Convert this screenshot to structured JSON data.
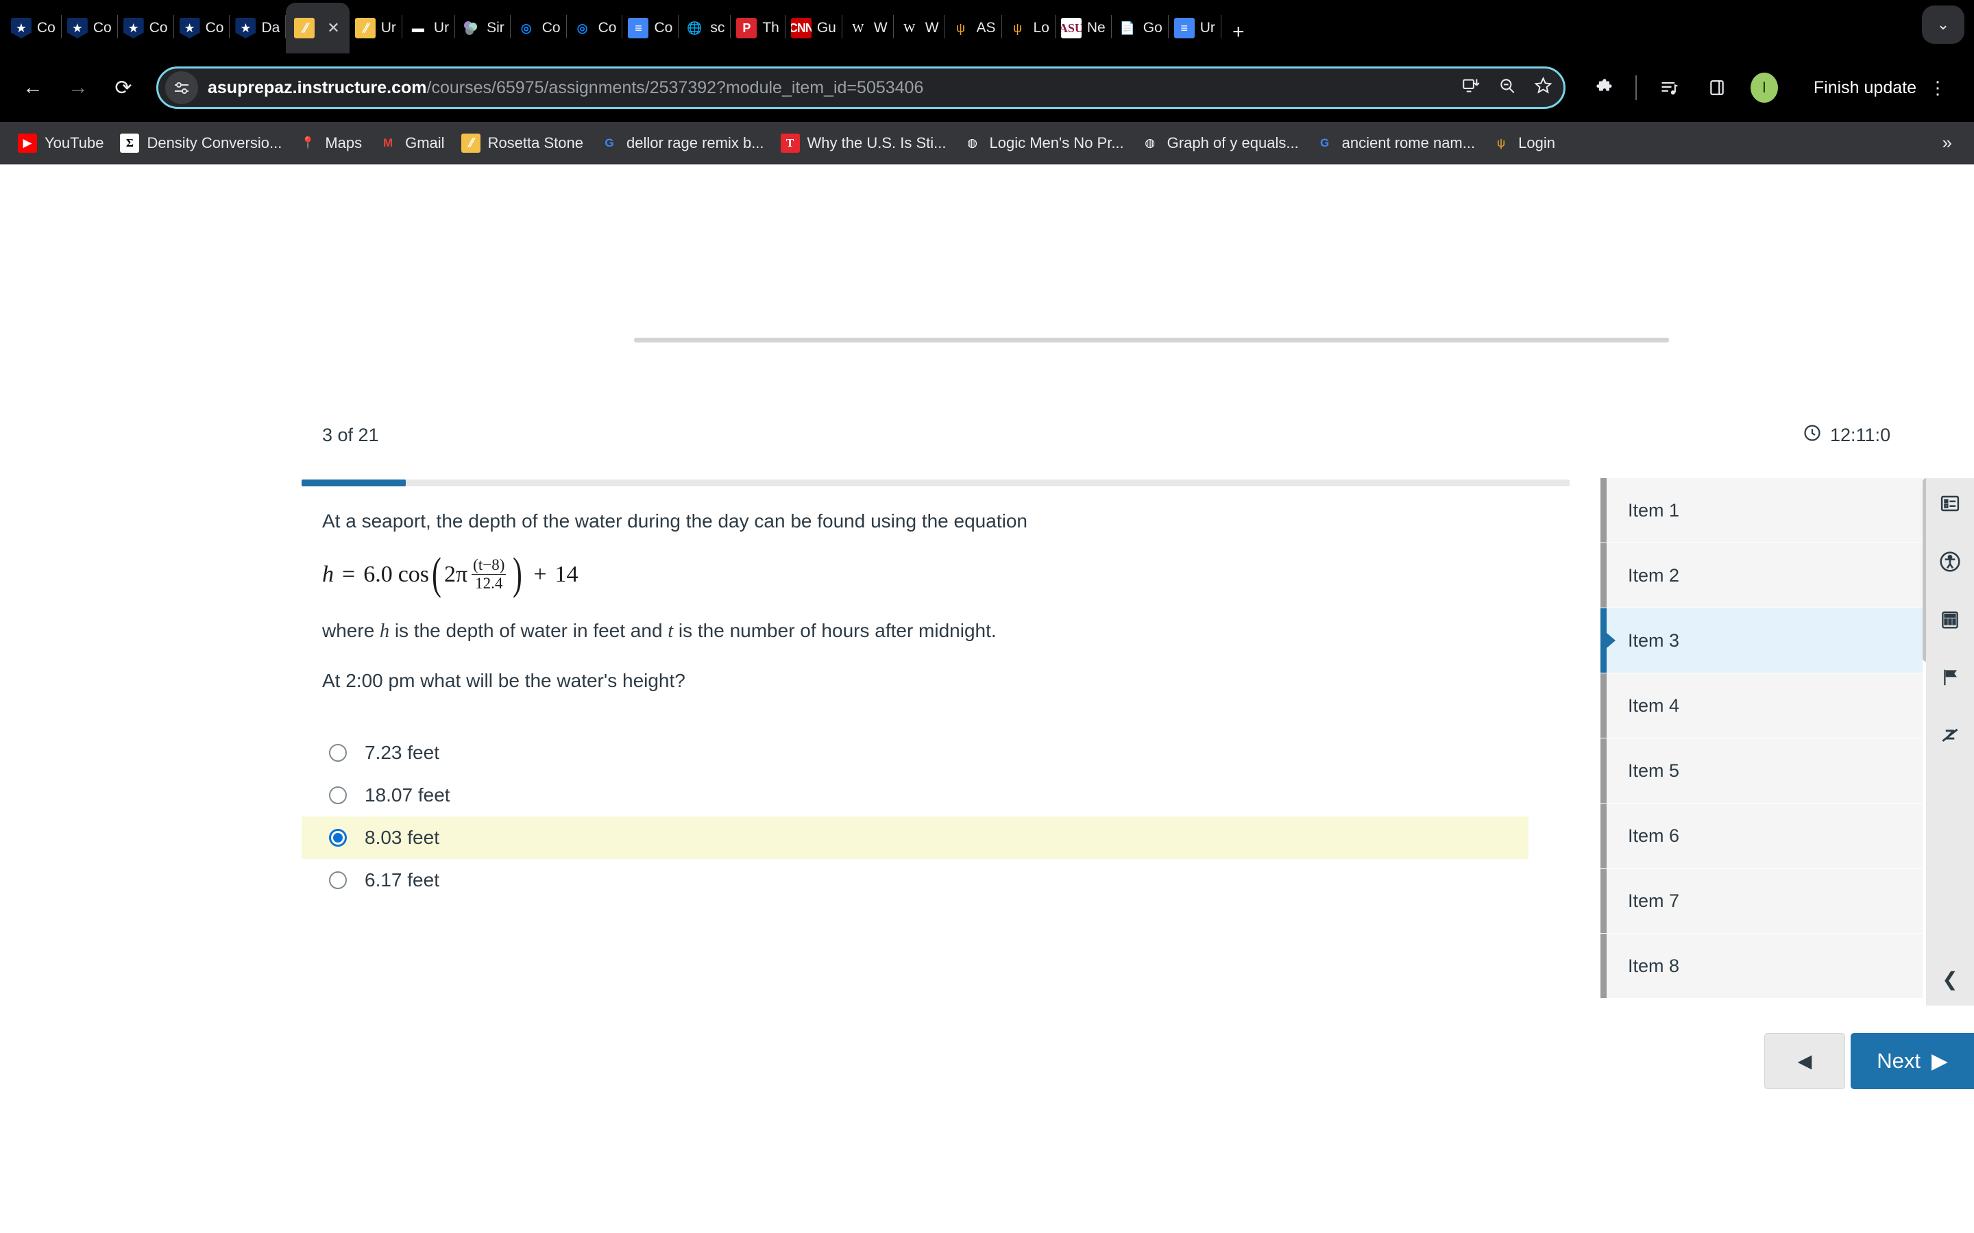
{
  "browser": {
    "tabs": [
      {
        "title": "Co",
        "icon": "canvas-icon",
        "active": false
      },
      {
        "title": "Co",
        "icon": "canvas-icon",
        "active": false
      },
      {
        "title": "Co",
        "icon": "canvas-icon",
        "active": false
      },
      {
        "title": "Co",
        "icon": "canvas-icon",
        "active": false
      },
      {
        "title": "Da",
        "icon": "canvas-icon",
        "active": false
      },
      {
        "title": "",
        "icon": "rosetta-stone-icon",
        "active": true
      },
      {
        "title": "Ur",
        "icon": "rosetta-stone-icon",
        "active": false
      },
      {
        "title": "Ur",
        "icon": "unit-converter-icon",
        "active": false
      },
      {
        "title": "Sir",
        "icon": "simulation-icon",
        "active": false
      },
      {
        "title": "Co",
        "icon": "coursehero-icon",
        "active": false
      },
      {
        "title": "Co",
        "icon": "coursehero-icon",
        "active": false
      },
      {
        "title": "Co",
        "icon": "google-docs-icon",
        "active": false
      },
      {
        "title": "sc",
        "icon": "globe-icon",
        "active": false
      },
      {
        "title": "Th",
        "icon": "pearson-icon",
        "active": false
      },
      {
        "title": "Gu",
        "icon": "cnn-icon",
        "active": false
      },
      {
        "title": "W",
        "icon": "wikipedia-icon",
        "active": false
      },
      {
        "title": "W",
        "icon": "wikipedia-icon",
        "active": false
      },
      {
        "title": "AS",
        "icon": "asu-pitchfork-icon",
        "active": false
      },
      {
        "title": "Lo",
        "icon": "asu-pitchfork-icon",
        "active": false
      },
      {
        "title": "Ne",
        "icon": "asu-logo-icon",
        "active": false
      },
      {
        "title": "Go",
        "icon": "google-doc-file-icon",
        "active": false
      },
      {
        "title": "Ur",
        "icon": "google-docs-icon",
        "active": false
      }
    ],
    "new_tab_label": "+",
    "tab_close_label": "✕",
    "nav": {
      "back": "←",
      "forward": "→",
      "reload": "⟳"
    },
    "omnibox": {
      "site_settings_icon": "tune-icon",
      "url_host": "asuprepaz.instructure.com",
      "url_path": "/courses/65975/assignments/2537392?module_item_id=5053406",
      "full_url": "asuprepaz.instructure.com/courses/65975/assignments/2537392?module_item_id=5053406",
      "install_icon": "install-app-icon",
      "zoom_icon": "zoom-out-icon",
      "bookmark_icon": "star-icon"
    },
    "toolbar": {
      "extensions_icon": "extensions-puzzle-icon",
      "reading_list_icon": "reading-list-icon",
      "side_panel_icon": "side-panel-icon",
      "profile_initial": "I",
      "finish_update_label": "Finish update",
      "menu_icon": "kebab-menu-icon"
    },
    "bookmarks": [
      {
        "label": "YouTube",
        "icon": "youtube-icon"
      },
      {
        "label": "Density Conversio...",
        "icon": "sigma-icon"
      },
      {
        "label": "Maps",
        "icon": "google-maps-icon"
      },
      {
        "label": "Gmail",
        "icon": "gmail-icon"
      },
      {
        "label": "Rosetta Stone",
        "icon": "rosetta-stone-icon"
      },
      {
        "label": "dellor rage remix b...",
        "icon": "google-icon"
      },
      {
        "label": "Why the U.S. Is Sti...",
        "icon": "time-magazine-icon"
      },
      {
        "label": "Logic Men's No Pr...",
        "icon": "socratic-icon"
      },
      {
        "label": "Graph of y equals...",
        "icon": "socratic-icon"
      },
      {
        "label": "ancient rome nam...",
        "icon": "google-icon"
      },
      {
        "label": "Login",
        "icon": "asu-pitchfork-icon"
      }
    ],
    "bookmarks_overflow_label": "»"
  },
  "quiz": {
    "position_label": "3 of 21",
    "timer_label": "12:11:0",
    "timer_icon": "clock-icon",
    "progress_percent": 8.2,
    "question": {
      "intro": "At a seaport, the depth of the water during the day can be found using the equation",
      "formula": {
        "lhs": "h",
        "equals": "=",
        "amplitude": "6.0",
        "function": "cos",
        "coefficient": "2π",
        "numerator": "(t−8)",
        "denominator": "12.4",
        "plus": "+",
        "vertical_shift": "14",
        "plain": "h = 6.0 cos(2π (t−8)/12.4) + 14"
      },
      "where_prefix": "where ",
      "where_var1": "h",
      "where_mid": " is the depth of water in feet and ",
      "where_var2": "t",
      "where_suffix": " is the number of hours after midnight.",
      "prompt": "At 2:00 pm what will be the water's height?"
    },
    "answers": [
      {
        "label": "7.23 feet",
        "selected": false
      },
      {
        "label": "18.07 feet",
        "selected": false
      },
      {
        "label": "8.03 feet",
        "selected": true
      },
      {
        "label": "6.17 feet",
        "selected": false
      }
    ],
    "items": [
      {
        "label": "Item 1",
        "current": false
      },
      {
        "label": "Item 2",
        "current": false
      },
      {
        "label": "Item 3",
        "current": true
      },
      {
        "label": "Item 4",
        "current": false
      },
      {
        "label": "Item 5",
        "current": false
      },
      {
        "label": "Item 6",
        "current": false
      },
      {
        "label": "Item 7",
        "current": false
      },
      {
        "label": "Item 8",
        "current": false
      }
    ],
    "rail_icons": [
      "question-list-icon",
      "accessibility-icon",
      "calculator-icon",
      "flag-icon",
      "strikethrough-icon"
    ],
    "collapse_label": "❮",
    "nav": {
      "prev_label": "◀",
      "next_label": "Next",
      "next_arrow": "▶"
    }
  },
  "colors": {
    "accent_blue": "#1d72ab",
    "selected_answer_bg": "#f9f9d7",
    "current_item_bg": "#e3f2fb",
    "omnibox_focus": "#7ad3e6",
    "radio_selected": "#0b72d4"
  }
}
